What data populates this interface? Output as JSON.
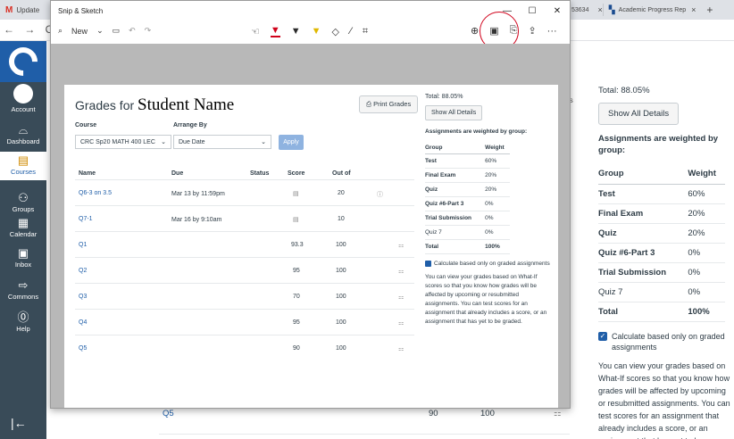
{
  "browser": {
    "tab_first_label": "Update",
    "tab_partial_text": "53634",
    "tab_active_label": "Academic Progress Rep",
    "close_glyph": "×",
    "new_tab_glyph": "+",
    "nav_arrows": "← → C"
  },
  "canvas_nav": {
    "items": [
      {
        "label": "Account",
        "icon": "avatar"
      },
      {
        "label": "Dashboard",
        "icon": "dashboard-icon"
      },
      {
        "label": "Courses",
        "icon": "book-icon"
      },
      {
        "label": "Groups",
        "icon": "groups-icon"
      },
      {
        "label": "Calendar",
        "icon": "calendar-icon"
      },
      {
        "label": "Inbox",
        "icon": "inbox-icon"
      },
      {
        "label": "Commons",
        "icon": "commons-icon"
      },
      {
        "label": "Help",
        "icon": "help-icon"
      }
    ],
    "collapse_glyph": "|←"
  },
  "background": {
    "total": "Total: 88.05%",
    "show_all": "Show All Details",
    "weighted": "Assignments are weighted by group:",
    "table_headers": [
      "Group",
      "Weight"
    ],
    "rows": [
      {
        "group": "Test",
        "weight": "60%"
      },
      {
        "group": "Final Exam",
        "weight": "20%"
      },
      {
        "group": "Quiz",
        "weight": "20%"
      },
      {
        "group": "Quiz #6-Part 3",
        "weight": "0%"
      },
      {
        "group": "Trial Submission",
        "weight": "0%"
      },
      {
        "group": "Quiz 7",
        "weight": "0%"
      },
      {
        "group": "Total",
        "weight": "100%"
      }
    ],
    "calc_label": "Calculate based only on graded assignments",
    "paragraph": "You can view your grades based on What-If scores so that you know how grades will be affected by upcoming or resubmitted assignments. You can test scores for an assignment that already includes a score, or an assignment that has yet to be graded.",
    "q5": {
      "name": "Q5",
      "score": "90",
      "out_of": "100"
    },
    "s_col": "is"
  },
  "snip": {
    "title": "Snip & Sketch",
    "new_label": "New",
    "win": {
      "min": "—",
      "max": "☐",
      "close": "✕"
    },
    "more": "···"
  },
  "page": {
    "title_prefix": "Grades for ",
    "student_name": "Student Name",
    "print_label": "Print Grades",
    "course_label": "Course",
    "course_value": "CRC Sp20 MATH 400 LEC",
    "arrange_label": "Arrange By",
    "arrange_value": "Due Date",
    "apply_label": "Apply",
    "headers": {
      "name": "Name",
      "due": "Due",
      "status": "Status",
      "score": "Score",
      "out_of": "Out of"
    },
    "rows": [
      {
        "name": "Q6-3 on 3.5",
        "due": "Mar 13 by 11:59pm",
        "score": "",
        "out_of": "20"
      },
      {
        "name": "Q7-1",
        "due": "Mar 16 by 9:10am",
        "score": "",
        "out_of": "10"
      },
      {
        "name": "Q1",
        "due": "",
        "score": "93.3",
        "out_of": "100"
      },
      {
        "name": "Q2",
        "due": "",
        "score": "95",
        "out_of": "100"
      },
      {
        "name": "Q3",
        "due": "",
        "score": "70",
        "out_of": "100"
      },
      {
        "name": "Q4",
        "due": "",
        "score": "95",
        "out_of": "100"
      },
      {
        "name": "Q5",
        "due": "",
        "score": "90",
        "out_of": "100"
      }
    ]
  },
  "colors": {
    "accent": "#1f5ea8",
    "nav_bg": "#394b58",
    "annotation": "#d0021b"
  }
}
